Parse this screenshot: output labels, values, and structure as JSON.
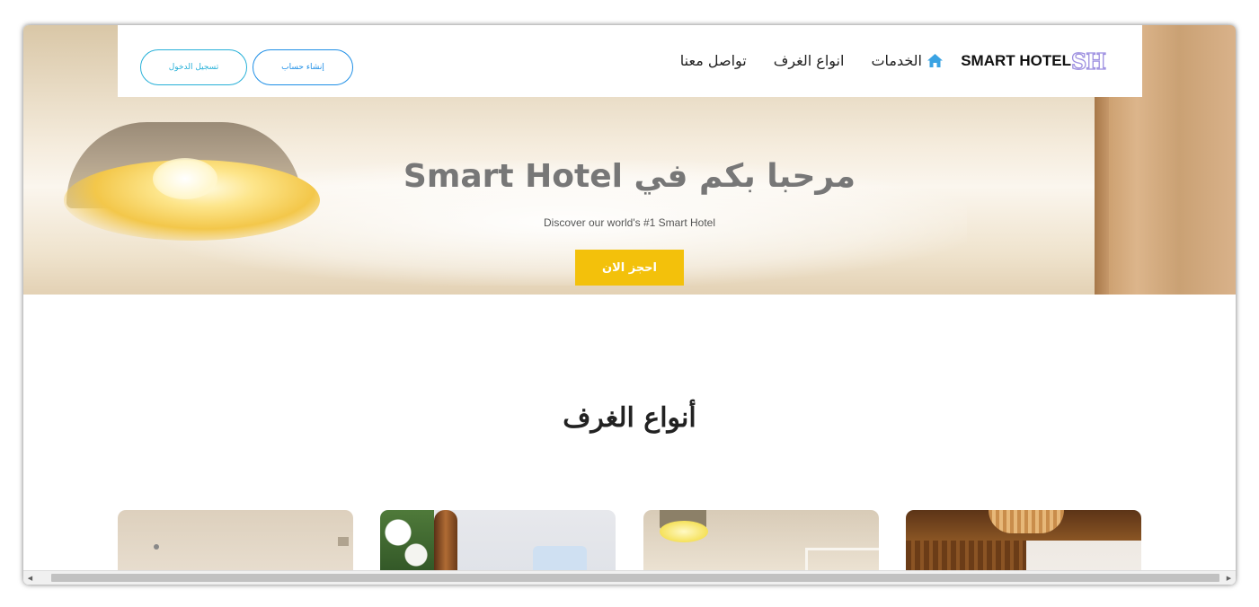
{
  "nav": {
    "logo_mark": "SH",
    "logo_text": "SMART HOTEL",
    "links": [
      {
        "label": "الخدمات",
        "icon": "home-icon"
      },
      {
        "label": "انواع الغرف"
      },
      {
        "label": "تواصل معنا"
      }
    ],
    "register_label": "إنشاء حساب",
    "login_label": "تسجيل الدخول"
  },
  "hero": {
    "title": "مرحبا بكم في Smart Hotel",
    "subtitle": "Discover our world's #1 Smart Hotel",
    "cta_label": "احجز الان"
  },
  "rooms": {
    "section_title": "أنواع الغرف",
    "cards": [
      "room-card-1",
      "room-card-2",
      "room-card-3",
      "room-card-4"
    ]
  },
  "colors": {
    "accent_yellow": "#f3c10b",
    "button_blue": "#1d8ee6",
    "button_cyan": "#26b0d8",
    "logo_purple": "#9d8fe0",
    "hero_title": "#777777"
  }
}
